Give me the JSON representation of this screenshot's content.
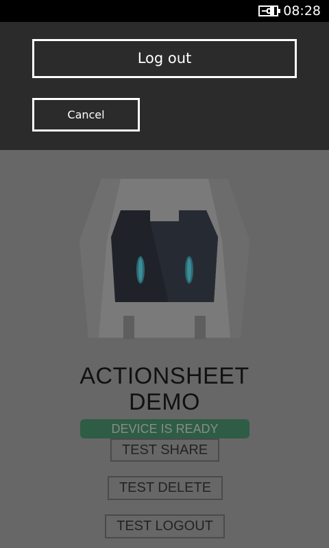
{
  "status_bar": {
    "time": "08:28",
    "battery_icon": "battery-charging-icon"
  },
  "action_sheet": {
    "primary_label": "Log out",
    "cancel_label": "Cancel"
  },
  "app": {
    "logo_icon": "cordova-robot-icon",
    "title_line1": "ACTIONSHEET",
    "title_line2": "DEMO",
    "status_text": "DEVICE IS READY",
    "buttons": {
      "share": "TEST SHARE",
      "delete": "TEST DELETE",
      "logout": "TEST LOGOUT"
    }
  },
  "colors": {
    "overlay_background": "#676767",
    "sheet_background": "#2b2b2b",
    "ready_badge": "#2f5c45"
  }
}
